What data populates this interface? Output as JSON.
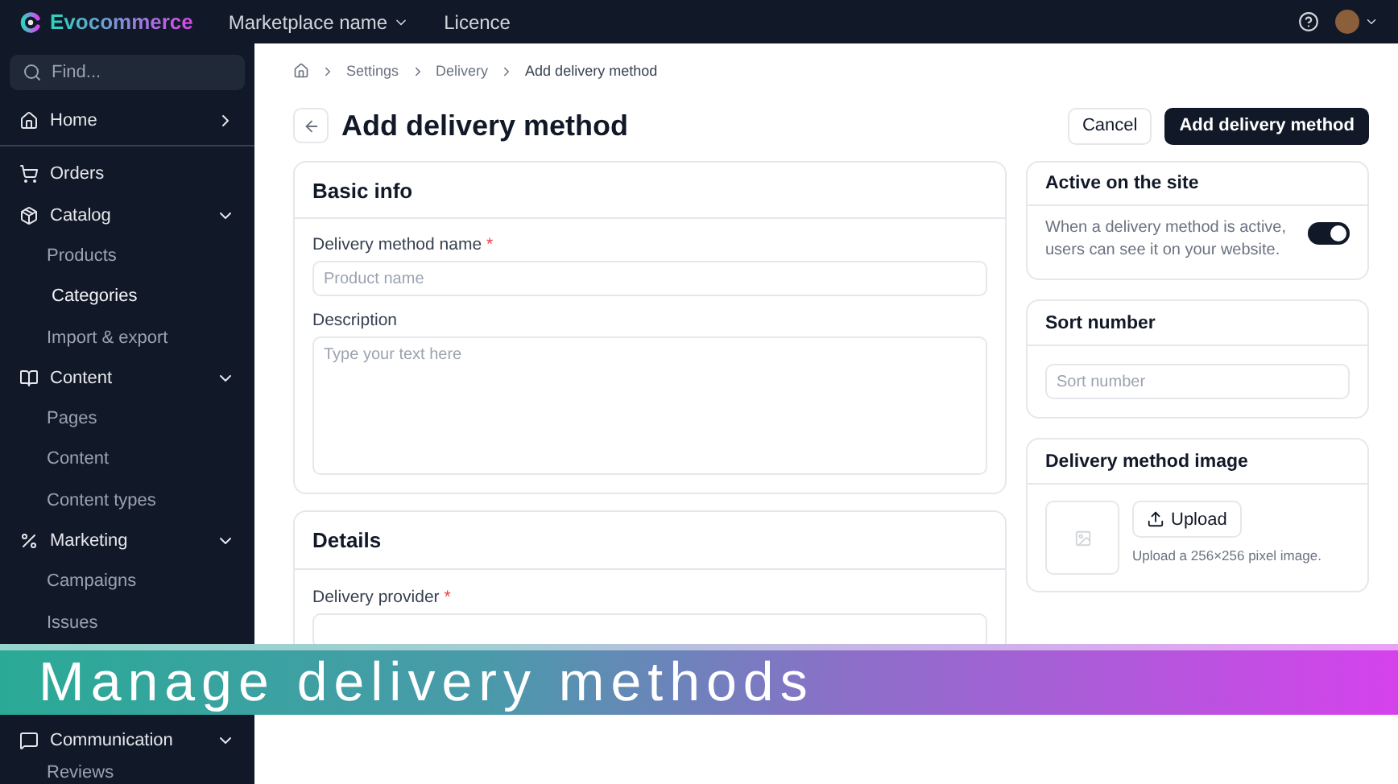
{
  "topbar": {
    "brand": "Evocommerce",
    "marketplace": "Marketplace name",
    "licence": "Licence"
  },
  "sidebar": {
    "search_placeholder": "Find...",
    "items": [
      {
        "label": "Home",
        "kind": "section",
        "expanded": false,
        "selected": false
      },
      {
        "kind": "divider"
      },
      {
        "label": "Orders",
        "kind": "section",
        "selected": false
      },
      {
        "label": "Catalog",
        "kind": "section",
        "expanded": true,
        "selected": false
      },
      {
        "label": "Products",
        "kind": "sub",
        "selected": false
      },
      {
        "label": "Categories",
        "kind": "sub",
        "selected": true
      },
      {
        "label": "Import & export",
        "kind": "sub",
        "selected": false
      },
      {
        "label": "Content",
        "kind": "section",
        "expanded": true,
        "selected": false
      },
      {
        "label": "Pages",
        "kind": "sub",
        "selected": false
      },
      {
        "label": "Content",
        "kind": "sub",
        "selected": false
      },
      {
        "label": "Content types",
        "kind": "sub",
        "selected": false
      },
      {
        "label": "Marketing",
        "kind": "section",
        "expanded": true,
        "selected": false
      },
      {
        "label": "Campaigns",
        "kind": "sub",
        "selected": false
      },
      {
        "label": "Issues",
        "kind": "sub",
        "selected": false
      }
    ],
    "bottom_items": [
      {
        "label": "Communication",
        "kind": "section",
        "expanded": true,
        "selected": false
      },
      {
        "label": "Reviews",
        "kind": "sub",
        "selected": false
      }
    ]
  },
  "breadcrumb": [
    "Settings",
    "Delivery",
    "Add delivery method"
  ],
  "page": {
    "title": "Add delivery method",
    "cancel": "Cancel",
    "submit": "Add delivery method"
  },
  "basic_info": {
    "title": "Basic info",
    "name_label": "Delivery method name",
    "name_required": true,
    "required_mark": "*",
    "name_placeholder": "Product name",
    "description_label": "Description",
    "description_placeholder": "Type your text here"
  },
  "details": {
    "title": "Details",
    "provider_label": "Delivery provider",
    "provider_required": true,
    "required_mark": "*"
  },
  "active": {
    "title": "Active on the site",
    "text": "When a delivery method is active, users can see it on your website.",
    "on": true
  },
  "sort": {
    "title": "Sort number",
    "placeholder": "Sort number"
  },
  "image": {
    "title": "Delivery method image",
    "upload": "Upload",
    "hint": "Upload a 256×256 pixel image."
  },
  "banner": {
    "text": "Manage delivery methods"
  }
}
